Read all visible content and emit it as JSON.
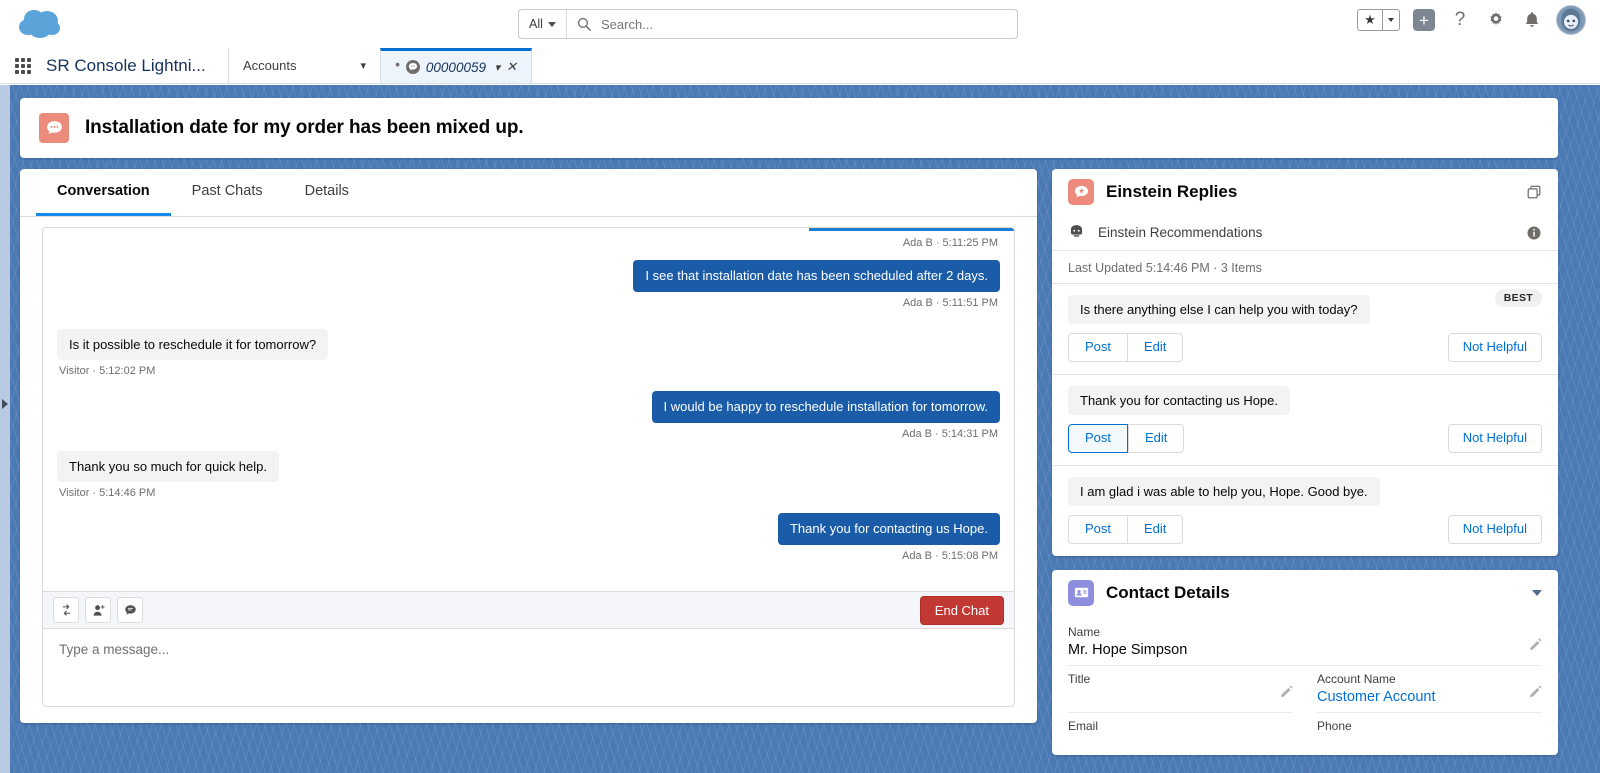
{
  "global_header": {
    "logo": "salesforce-cloud-logo",
    "search": {
      "scope": "All",
      "placeholder": "Search..."
    },
    "actions": [
      {
        "name": "favorites-star",
        "icon": "star-icon"
      },
      {
        "name": "favorites-dropdown",
        "icon": "chevron-down-icon"
      },
      {
        "name": "add-button",
        "icon": "plus-icon"
      },
      {
        "name": "help-button",
        "icon": "question-icon"
      },
      {
        "name": "setup-button",
        "icon": "gear-icon"
      },
      {
        "name": "notifications-button",
        "icon": "bell-icon"
      },
      {
        "name": "user-avatar",
        "icon": "avatar-icon"
      }
    ]
  },
  "console": {
    "app_name": "SR Console Lightni...",
    "tabs": [
      {
        "label": "Accounts",
        "active": false,
        "has_chevron": true
      },
      {
        "label": "00000059",
        "active": true,
        "unsaved": true,
        "icon": "chat-icon"
      }
    ]
  },
  "highlight_panel": {
    "icon": "chat-icon",
    "title": "Installation date for my order has been mixed up."
  },
  "conversation": {
    "tabs": [
      {
        "label": "Conversation",
        "active": true
      },
      {
        "label": "Past Chats",
        "active": false
      },
      {
        "label": "Details",
        "active": false
      }
    ],
    "messages": [
      {
        "side": "agent",
        "text": "",
        "meta": "Ada B · 5:11:25 PM",
        "hidden_bubble": true
      },
      {
        "side": "agent",
        "text": "I see that installation date has been scheduled after 2 days.",
        "meta": "Ada B · 5:11:51 PM"
      },
      {
        "side": "visitor",
        "text": "Is it possible to reschedule it for tomorrow?",
        "meta": "Visitor · 5:12:02 PM"
      },
      {
        "side": "agent",
        "text": "I would be happy to reschedule installation for tomorrow.",
        "meta": "Ada B · 5:14:31 PM"
      },
      {
        "side": "visitor",
        "text": "Thank you so much for quick help.",
        "meta": "Visitor · 5:14:46 PM"
      },
      {
        "side": "agent",
        "text": "Thank you for contacting us Hope.",
        "meta": "Ada B · 5:15:08 PM"
      }
    ],
    "toolbar": [
      {
        "name": "transfer-chat-icon",
        "icon": "transfer-icon"
      },
      {
        "name": "invite-agent-icon",
        "icon": "person-add-icon"
      },
      {
        "name": "quick-text-icon",
        "icon": "quick-text-icon"
      }
    ],
    "end_chat_label": "End Chat",
    "composer_placeholder": "Type a message..."
  },
  "einstein_replies": {
    "title": "Einstein Replies",
    "icon": "einstein-icon",
    "expand_icon": "popout-icon",
    "source_row": {
      "label": "Einstein Recommendations",
      "icon": "einstein-head-icon",
      "info_icon": "info-icon"
    },
    "last_updated": "Last Updated 5:14:46 PM · 3 Items",
    "best_badge": "BEST",
    "recommendations": [
      {
        "text": "Is there anything else I can help you with today?",
        "best": true,
        "post": "Post",
        "edit": "Edit",
        "not_helpful": "Not Helpful",
        "post_focused": false
      },
      {
        "text": "Thank you for contacting us Hope.",
        "best": false,
        "post": "Post",
        "edit": "Edit",
        "not_helpful": "Not Helpful",
        "post_focused": true
      },
      {
        "text": "I am glad i was able to help you, Hope. Good bye.",
        "best": false,
        "post": "Post",
        "edit": "Edit",
        "not_helpful": "Not Helpful",
        "post_focused": false
      }
    ]
  },
  "contact_details": {
    "title": "Contact Details",
    "icon": "contact-card-icon",
    "collapse_icon": "caret-down-icon",
    "fields": {
      "name_label": "Name",
      "name_value": "Mr. Hope Simpson",
      "title_label": "Title",
      "title_value": "",
      "account_label": "Account Name",
      "account_value": "Customer Account",
      "email_label": "Email",
      "phone_label": "Phone"
    }
  },
  "colors": {
    "brand_blue": "#0070d2",
    "agent_bubble": "#1a5ca8",
    "visitor_bubble": "#f3f3f3",
    "end_chat_red": "#c23934",
    "einstein_orange": "#ec8a7b",
    "contact_purple": "#8e8ede",
    "workspace_blue": "#4a79b4"
  }
}
